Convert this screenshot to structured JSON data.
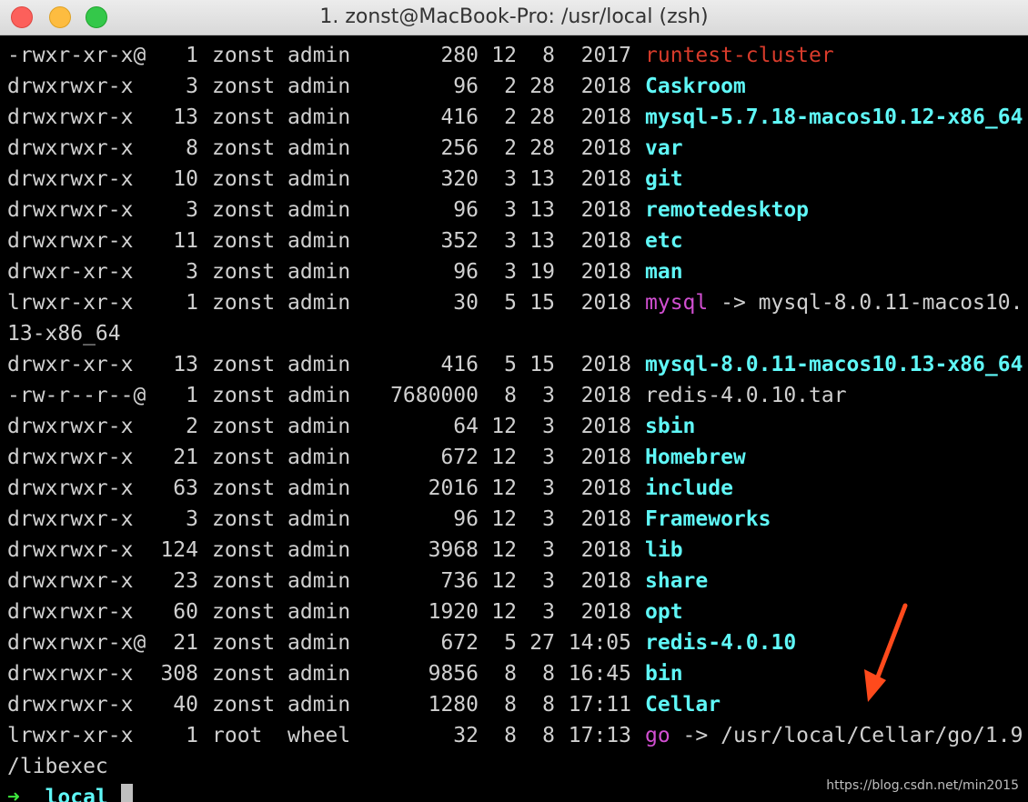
{
  "window": {
    "title": "1. zonst@MacBook-Pro: /usr/local (zsh)"
  },
  "listing": [
    {
      "perm": "-rwxr-xr-x@",
      "links": "1",
      "user": "zonst",
      "group": "admin",
      "size": "280",
      "month": "12",
      "day": "8",
      "time": "2017",
      "name": "runtest-cluster",
      "kind": "exec",
      "target": ""
    },
    {
      "perm": "drwxrwxr-x",
      "links": "3",
      "user": "zonst",
      "group": "admin",
      "size": "96",
      "month": "2",
      "day": "28",
      "time": "2018",
      "name": "Caskroom",
      "kind": "dir",
      "target": ""
    },
    {
      "perm": "drwxrwxr-x",
      "links": "13",
      "user": "zonst",
      "group": "admin",
      "size": "416",
      "month": "2",
      "day": "28",
      "time": "2018",
      "name": "mysql-5.7.18-macos10.12-x86_64",
      "kind": "dir",
      "target": ""
    },
    {
      "perm": "drwxrwxr-x",
      "links": "8",
      "user": "zonst",
      "group": "admin",
      "size": "256",
      "month": "2",
      "day": "28",
      "time": "2018",
      "name": "var",
      "kind": "dir",
      "target": ""
    },
    {
      "perm": "drwxrwxr-x",
      "links": "10",
      "user": "zonst",
      "group": "admin",
      "size": "320",
      "month": "3",
      "day": "13",
      "time": "2018",
      "name": "git",
      "kind": "dir",
      "target": ""
    },
    {
      "perm": "drwxrwxr-x",
      "links": "3",
      "user": "zonst",
      "group": "admin",
      "size": "96",
      "month": "3",
      "day": "13",
      "time": "2018",
      "name": "remotedesktop",
      "kind": "dir",
      "target": ""
    },
    {
      "perm": "drwxrwxr-x",
      "links": "11",
      "user": "zonst",
      "group": "admin",
      "size": "352",
      "month": "3",
      "day": "13",
      "time": "2018",
      "name": "etc",
      "kind": "dir",
      "target": ""
    },
    {
      "perm": "drwxr-xr-x",
      "links": "3",
      "user": "zonst",
      "group": "admin",
      "size": "96",
      "month": "3",
      "day": "19",
      "time": "2018",
      "name": "man",
      "kind": "dir",
      "target": ""
    },
    {
      "perm": "lrwxr-xr-x",
      "links": "1",
      "user": "zonst",
      "group": "admin",
      "size": "30",
      "month": "5",
      "day": "15",
      "time": "2018",
      "name": "mysql",
      "kind": "link",
      "target": " -> mysql-8.0.11-macos10.",
      "wrap": "13-x86_64"
    },
    {
      "perm": "drwxr-xr-x",
      "links": "13",
      "user": "zonst",
      "group": "admin",
      "size": "416",
      "month": "5",
      "day": "15",
      "time": "2018",
      "name": "mysql-8.0.11-macos10.13-x86_64",
      "kind": "dir",
      "target": ""
    },
    {
      "perm": "-rw-r--r--@",
      "links": "1",
      "user": "zonst",
      "group": "admin",
      "size": "7680000",
      "month": "8",
      "day": "3",
      "time": "2018",
      "name": "redis-4.0.10.tar",
      "kind": "plain",
      "target": ""
    },
    {
      "perm": "drwxrwxr-x",
      "links": "2",
      "user": "zonst",
      "group": "admin",
      "size": "64",
      "month": "12",
      "day": "3",
      "time": "2018",
      "name": "sbin",
      "kind": "dir",
      "target": ""
    },
    {
      "perm": "drwxrwxr-x",
      "links": "21",
      "user": "zonst",
      "group": "admin",
      "size": "672",
      "month": "12",
      "day": "3",
      "time": "2018",
      "name": "Homebrew",
      "kind": "dir",
      "target": ""
    },
    {
      "perm": "drwxrwxr-x",
      "links": "63",
      "user": "zonst",
      "group": "admin",
      "size": "2016",
      "month": "12",
      "day": "3",
      "time": "2018",
      "name": "include",
      "kind": "dir",
      "target": ""
    },
    {
      "perm": "drwxrwxr-x",
      "links": "3",
      "user": "zonst",
      "group": "admin",
      "size": "96",
      "month": "12",
      "day": "3",
      "time": "2018",
      "name": "Frameworks",
      "kind": "dir",
      "target": ""
    },
    {
      "perm": "drwxrwxr-x",
      "links": "124",
      "user": "zonst",
      "group": "admin",
      "size": "3968",
      "month": "12",
      "day": "3",
      "time": "2018",
      "name": "lib",
      "kind": "dir",
      "target": ""
    },
    {
      "perm": "drwxrwxr-x",
      "links": "23",
      "user": "zonst",
      "group": "admin",
      "size": "736",
      "month": "12",
      "day": "3",
      "time": "2018",
      "name": "share",
      "kind": "dir",
      "target": ""
    },
    {
      "perm": "drwxrwxr-x",
      "links": "60",
      "user": "zonst",
      "group": "admin",
      "size": "1920",
      "month": "12",
      "day": "3",
      "time": "2018",
      "name": "opt",
      "kind": "dir",
      "target": ""
    },
    {
      "perm": "drwxrwxr-x@",
      "links": "21",
      "user": "zonst",
      "group": "admin",
      "size": "672",
      "month": "5",
      "day": "27",
      "time": "14:05",
      "name": "redis-4.0.10",
      "kind": "dir",
      "target": ""
    },
    {
      "perm": "drwxrwxr-x",
      "links": "308",
      "user": "zonst",
      "group": "admin",
      "size": "9856",
      "month": "8",
      "day": "8",
      "time": "16:45",
      "name": "bin",
      "kind": "dir",
      "target": ""
    },
    {
      "perm": "drwxrwxr-x",
      "links": "40",
      "user": "zonst",
      "group": "admin",
      "size": "1280",
      "month": "8",
      "day": "8",
      "time": "17:11",
      "name": "Cellar",
      "kind": "dir",
      "target": ""
    },
    {
      "perm": "lrwxr-xr-x",
      "links": "1",
      "user": "root",
      "group": "wheel",
      "size": "32",
      "month": "8",
      "day": "8",
      "time": "17:13",
      "name": "go",
      "kind": "link",
      "target": " -> /usr/local/Cellar/go/1.9",
      "wrap": "/libexec"
    }
  ],
  "prompt": {
    "arrow": "➜",
    "dir": "local"
  },
  "watermark": "https://blog.csdn.net/min2015",
  "colors": {
    "dir": "#5ff7f7",
    "link": "#d14fd1",
    "exec": "#d83b2b",
    "prompt_arrow": "#3ee83e",
    "annotation_arrow": "#ff4a1c"
  },
  "icons": {
    "close": "close-button-icon",
    "minimize": "minimize-button-icon",
    "zoom": "zoom-button-icon",
    "annotation": "annotation-arrow-icon"
  }
}
